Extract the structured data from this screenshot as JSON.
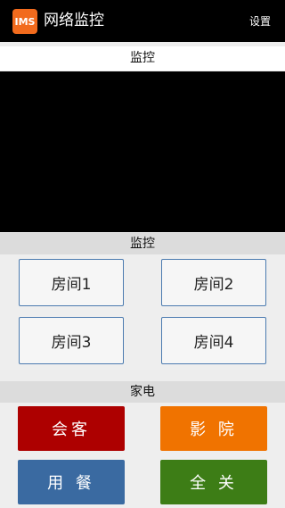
{
  "app": {
    "icon_text": "IMS",
    "title": "网络监控",
    "settings_label": "设置"
  },
  "video_section": {
    "header": "监控"
  },
  "rooms_section": {
    "header": "监控",
    "rooms": [
      {
        "label": "房间1"
      },
      {
        "label": "房间2"
      },
      {
        "label": "房间3"
      },
      {
        "label": "房间4"
      }
    ]
  },
  "appliances_section": {
    "header": "家电",
    "buttons": [
      {
        "label": "会客",
        "color": "#ad0000"
      },
      {
        "label": "影 院",
        "color": "#f07300"
      },
      {
        "label": "用 餐",
        "color": "#3a6aa1"
      },
      {
        "label": "全 关",
        "color": "#3d7d16"
      }
    ]
  },
  "colors": {
    "action_bar": "#000000",
    "app_icon": "#f26b1d",
    "room_button_border": "#4c7bb0"
  }
}
